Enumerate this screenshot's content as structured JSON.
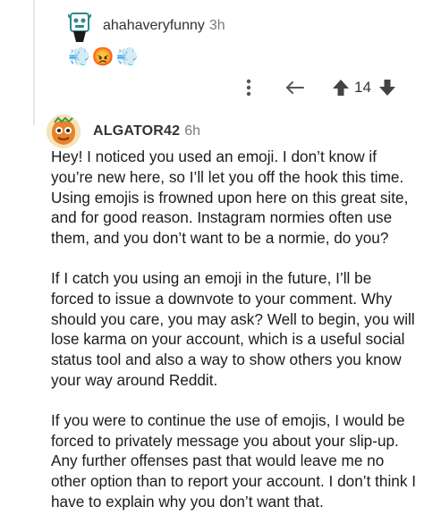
{
  "parent_comment": {
    "username": "ahahaveryfunny",
    "time": "3h",
    "emojis": [
      {
        "icon": "dash-icon",
        "glyph": "💨"
      },
      {
        "icon": "angry-face-icon",
        "glyph": "😡"
      },
      {
        "icon": "dash-icon",
        "glyph": "💨"
      }
    ],
    "score": "14"
  },
  "reply": {
    "username": "ALGATOR42",
    "time": "6h",
    "paragraphs": [
      "Hey! I noticed you used an emoji. I don’t know if you’re new here, so I’ll let you off the hook this time. Using emojis is frowned upon here on this great site, and for good reason. Instagram normies often use them, and you don’t want to be a normie, do you?",
      "If I catch you using an emoji in the future, I’ll be forced to issue a downvote to your comment. Why should you care, you may ask? Well to begin, you will lose karma on your account, which is a useful social status tool and also a way to show others you know your way around Reddit.",
      "If you were to continue the use of emojis, I would be forced to privately message you about your slip-up. Any further offenses past that would leave me no other option than to report your account. I don’t think I have to explain why you don’t want that."
    ]
  },
  "colors": {
    "text": "#1c1c1c",
    "meta": "#7c7c7c",
    "icon": "#555555",
    "thread_line": "#e6e6e6"
  }
}
